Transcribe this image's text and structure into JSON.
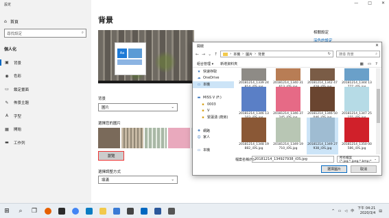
{
  "window": {
    "title": "設定",
    "controls": {
      "minimize": "—",
      "maximize": "□",
      "close": "✕"
    }
  },
  "sidebar": {
    "home": "首頁",
    "search_placeholder": "尋找設定",
    "section": "個人化",
    "items": [
      {
        "label": "背景",
        "icon": "image-icon"
      },
      {
        "label": "色彩",
        "icon": "palette-icon"
      },
      {
        "label": "鎖定畫面",
        "icon": "lock-screen-icon"
      },
      {
        "label": "佈景主題",
        "icon": "brush-icon"
      },
      {
        "label": "字型",
        "icon": "font-icon"
      },
      {
        "label": "開始",
        "icon": "start-icon"
      },
      {
        "label": "工作列",
        "icon": "taskbar-icon"
      }
    ]
  },
  "main": {
    "title": "背景",
    "preview_tile_text": "Aa",
    "background_label": "背景",
    "background_value": "圖片",
    "choose_picture_label": "選擇您的圖片",
    "browse_button": "瀏覽",
    "fit_label": "選擇調整方式",
    "fit_value": "填滿",
    "thumbnail_colors": [
      "#7a6a5a",
      "#c7b9a4",
      "#a9b8a6",
      "#e9a9bd",
      "#cfd8dc"
    ]
  },
  "right_column": {
    "title": "相關設定",
    "link": "深色的設定"
  },
  "dialog": {
    "title": "開啟",
    "close": "✕",
    "breadcrumb": [
      "本機",
      "圖片",
      "背景"
    ],
    "search_placeholder": "搜尋 背景",
    "organize": "組合管理 ▾",
    "new_folder": "新增資料夾",
    "nav_items": [
      {
        "label": "快速存取",
        "icon": "star-icon"
      },
      {
        "label": "OneDrive",
        "icon": "cloud-icon"
      },
      {
        "label": "本機",
        "icon": "computer-icon",
        "selected": true
      },
      {
        "label": "",
        "icon": "blank-icon"
      },
      {
        "label": "MISS V (F:)",
        "icon": "drive-icon"
      },
      {
        "label": "0003",
        "icon": "folder-icon"
      },
      {
        "label": "V",
        "icon": "folder-icon"
      },
      {
        "label": "緊蓮湧 (廚房)",
        "icon": "folder-icon"
      },
      {
        "label": "",
        "icon": "blank-icon"
      },
      {
        "label": "網路",
        "icon": "network-icon"
      },
      {
        "label": "家人",
        "icon": "people-icon"
      },
      {
        "label": "",
        "icon": "blank-icon"
      },
      {
        "label": "本機",
        "icon": "computer-icon"
      }
    ],
    "files": [
      {
        "name": "20181214_1339 24814_iOS.jpg",
        "color": "#8e8b86"
      },
      {
        "name": "20181214_1340 31613_iOS.jpg",
        "color": "#b87d55"
      },
      {
        "name": "20181214_1342 47428_iOS.jpg",
        "color": "#7a5c46"
      },
      {
        "name": "20181214_1344 13777_iOS.jpg",
        "color": "#6aa0c9"
      },
      {
        "name": "20181214_1346 13103_iOS.jpg",
        "color": "#5a7fc6"
      },
      {
        "name": "20181214_1346 37245_iOS.jpg",
        "color": "#e66a86"
      },
      {
        "name": "20181214_1346 50046_iOS.jpg",
        "color": "#6a4530"
      },
      {
        "name": "20181214_1347 25155_iOS.jpg",
        "color": "#b6dbe6"
      },
      {
        "name": "20181214_1348 19882_iOS.jpg",
        "color": "#8a5836"
      },
      {
        "name": "20181214_1349 19710_iOS.jpg",
        "color": "#b8c6b4"
      },
      {
        "name": "20181214_1349 27938_iOS.jpg",
        "color": "#9fbcd2",
        "selected": true
      },
      {
        "name": "20181214_1350 00586_iOS.jpg",
        "color": "#d0202a"
      }
    ],
    "filename_label": "檔案名稱(N):",
    "filename_value": "20181214_134927938_iOS.jpg",
    "filetype": "所有檔案 (*.jpg;*.jpeg;*.bmp;*",
    "choose_button": "選擇圖片",
    "cancel_button": "取消"
  },
  "taskbar": {
    "apps": [
      {
        "name": "start-icon",
        "color": "#1b1b1b"
      },
      {
        "name": "search-icon",
        "color": "#333333"
      },
      {
        "name": "task-view-icon",
        "color": "#333333"
      },
      {
        "name": "firefox-icon",
        "color": "#e66000"
      },
      {
        "name": "app-icon",
        "color": "#2b2b2b"
      },
      {
        "name": "chrome-icon",
        "color": "#4285f4"
      },
      {
        "name": "edge-icon",
        "color": "#0a7cc2"
      },
      {
        "name": "folder-icon",
        "color": "#f2c94c"
      },
      {
        "name": "image-viewer-icon",
        "color": "#3a7bd5"
      },
      {
        "name": "store-icon",
        "color": "#444444"
      },
      {
        "name": "mail-icon",
        "color": "#0067c0"
      },
      {
        "name": "word-icon",
        "color": "#2b579a"
      },
      {
        "name": "settings-icon",
        "color": "#555555"
      }
    ],
    "tray_text": "中",
    "time": "下午 04:21",
    "date": "2020/3/4"
  }
}
